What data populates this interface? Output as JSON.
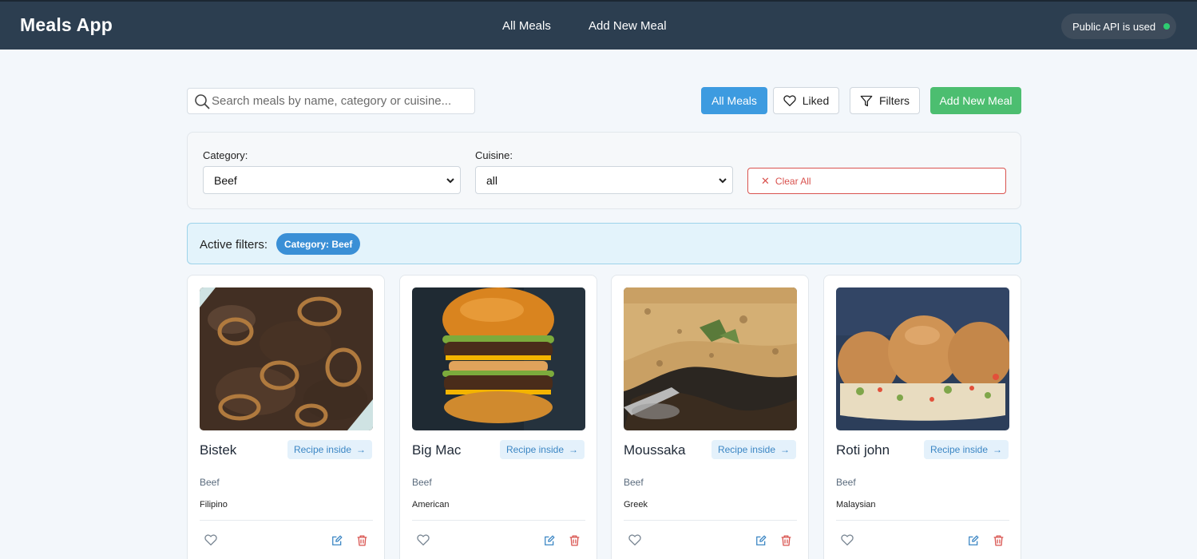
{
  "navbar": {
    "brand": "Meals App",
    "links": [
      "All Meals",
      "Add New Meal"
    ],
    "api_status": "Public API is used",
    "api_status_color": "#2ecc71",
    "background": "#2c3e50"
  },
  "toolbar": {
    "search_placeholder": "Search meals by name, category or cuisine...",
    "all_meals": "All Meals",
    "liked": "Liked",
    "filters": "Filters",
    "add_new": "Add New Meal"
  },
  "filters": {
    "category_label": "Category:",
    "category_value": "Beef",
    "cuisine_label": "Cuisine:",
    "cuisine_value": "all",
    "clear_all": "Clear All"
  },
  "active_filters": {
    "label": "Active filters:",
    "chips": [
      "Category: Beef"
    ]
  },
  "meals": [
    {
      "name": "Bistek",
      "category": "Beef",
      "cuisine": "Filipino",
      "recipe_label": "Recipe inside",
      "image": "bistek-photo"
    },
    {
      "name": "Big Mac",
      "category": "Beef",
      "cuisine": "American",
      "recipe_label": "Recipe inside",
      "image": "big-mac-photo"
    },
    {
      "name": "Moussaka",
      "category": "Beef",
      "cuisine": "Greek",
      "recipe_label": "Recipe inside",
      "image": "moussaka-photo"
    },
    {
      "name": "Roti john",
      "category": "Beef",
      "cuisine": "Malaysian",
      "recipe_label": "Recipe inside",
      "image": "roti-john-photo"
    }
  ]
}
